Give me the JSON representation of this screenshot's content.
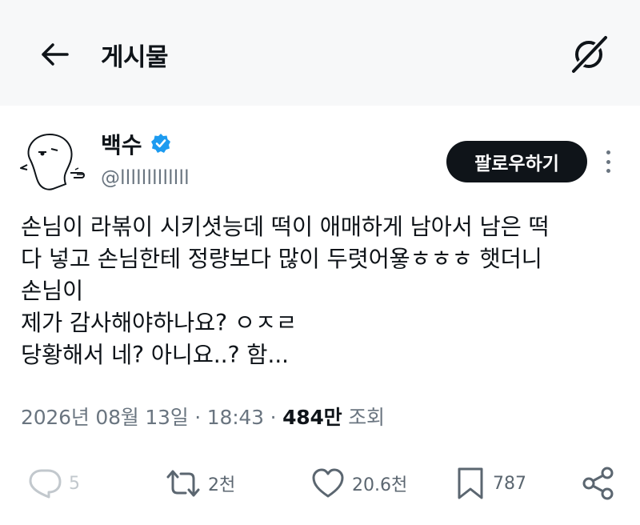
{
  "header": {
    "title": "게시물",
    "back_icon": "arrow-left-icon",
    "grok_icon": "grok-icon"
  },
  "author": {
    "display_name": "백수",
    "handle": "@lllllllllllll",
    "verified_color": "#1d9bf0",
    "avatar_icon": "cartoon-avatar-icon"
  },
  "follow_button": {
    "label": "팔로우하기"
  },
  "more_icon": "more-vertical-icon",
  "tweet": {
    "lines": [
      "손님이 라볶이 시키셧능데 떡이 애매하게 남아서 남은 떡",
      "다 넣고 손님한테 정량보다 많이 두렷어욯ㅎㅎㅎ 햇더니",
      "손님이",
      "제가 감사해야하나요? ㅇㅈㄹ",
      "당황해서 네? 아니요..? 함..."
    ]
  },
  "meta": {
    "timestamp": "2026년 08월 13일 · 18:43",
    "separator": "·",
    "views": "484만",
    "views_label": "조회"
  },
  "actions": {
    "reply": {
      "icon": "reply-icon",
      "count": "5"
    },
    "retweet": {
      "icon": "retweet-icon",
      "count": "2천"
    },
    "like": {
      "icon": "heart-icon",
      "count": "20.6천"
    },
    "bookmark": {
      "icon": "bookmark-icon",
      "count": "787"
    },
    "share": {
      "icon": "share-icon"
    }
  },
  "colors": {
    "text": "#0f1419",
    "secondary": "#6a7580",
    "button_bg": "#0f1419",
    "header_bg": "#f7f8f9"
  }
}
